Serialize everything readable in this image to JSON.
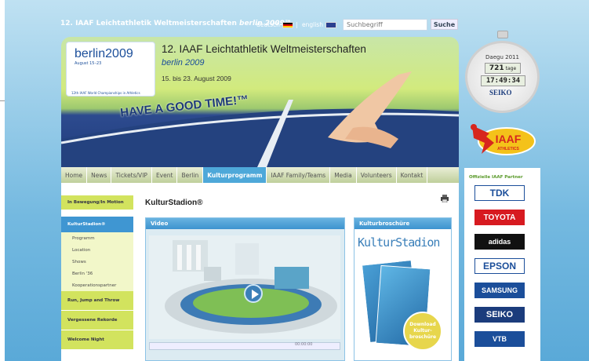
{
  "topbar": {
    "title": "12. IAAF Leichtathletik Weltmeisterschaften",
    "title_em": "berlin 2009™",
    "lang_de": "deutsch",
    "lang_sep": "|",
    "lang_en": "english",
    "search_placeholder": "Suchbegriff",
    "search_button": "Suche"
  },
  "banner": {
    "logo_city": "berlin",
    "logo_year": "2009",
    "logo_date": "August 15–23",
    "logo_bottom": "12th IAAF World Championships in Athletics",
    "title": "12. IAAF Leichtathletik Weltmeisterschaften",
    "city": "berlin",
    "city_year": "2009",
    "dates": "15. bis 23. August 2009",
    "slogan": "HAVE A GOOD TIME!™"
  },
  "nav": [
    "Home",
    "News",
    "Tickets/VIP",
    "Event",
    "Berlin",
    "Kulturprogramm",
    "IAAF Family/Teams",
    "Media",
    "Volunteers",
    "Kontakt"
  ],
  "nav_active": "Kulturprogramm",
  "leftnav": {
    "items": [
      {
        "label": "In Bewegung/In Motion",
        "type": "main"
      },
      {
        "label": "KulturStadion®",
        "type": "sel"
      },
      {
        "label": "Programm",
        "type": "sub"
      },
      {
        "label": "Location",
        "type": "sub"
      },
      {
        "label": "Shows",
        "type": "sub"
      },
      {
        "label": "Berlin '36",
        "type": "sub"
      },
      {
        "label": "Kooperationspartner",
        "type": "sub"
      },
      {
        "label": "Run, Jump and Throw",
        "type": "main"
      },
      {
        "label": "Vergessene Rekorde",
        "type": "main"
      },
      {
        "label": "Welcome Night",
        "type": "main"
      }
    ]
  },
  "main": {
    "title": "KulturStadion®",
    "video_header": "Video",
    "video_time": "00:00:00",
    "brochure_header": "Kulturbroschüre",
    "brochure_logo": "KulturStadion",
    "download_line1": "Download",
    "download_line2": "Kultur-",
    "download_line3": "broschüre"
  },
  "countdown": {
    "city": "Daegu 2011",
    "days": "721",
    "days_label": "tage",
    "time": "17:49:34",
    "brand": "SEIKO"
  },
  "iaaf": {
    "text": "IAAF",
    "sub": "ATHLETICS"
  },
  "sidebar": {
    "title": "Offizielle IAAF Partner",
    "sponsors": [
      {
        "name": "TDK",
        "color": "#1b4e9a",
        "bg": "#fff"
      },
      {
        "name": "TOYOTA",
        "color": "#fff",
        "bg": "#d71a20"
      },
      {
        "name": "adidas",
        "color": "#fff",
        "bg": "#111"
      },
      {
        "name": "EPSON",
        "color": "#1b4e9a",
        "bg": "#fff"
      },
      {
        "name": "SAMSUNG",
        "color": "#fff",
        "bg": "#1b4e9a"
      },
      {
        "name": "SEIKO",
        "color": "#fff",
        "bg": "#1b3c7c"
      },
      {
        "name": "VTB",
        "color": "#fff",
        "bg": "#1b4e9a"
      }
    ]
  }
}
